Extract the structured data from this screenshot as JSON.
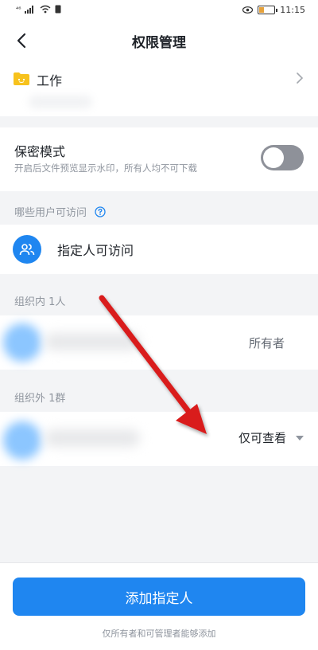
{
  "status_bar": {
    "signal_text": "⁴⁶",
    "time": "11:15",
    "battery_level": 0.35,
    "battery_color": "#e6a23c"
  },
  "nav": {
    "title": "权限管理",
    "back_icon": "chevron-left-icon"
  },
  "folder": {
    "name": "工作",
    "icon": "folder-icon",
    "icon_color": "#f7c21d"
  },
  "secret_mode": {
    "title": "保密模式",
    "description": "开启后文件预览显示水印，所有人均不可下载",
    "enabled": false
  },
  "access": {
    "section_label": "哪些用户可访问",
    "option_label": "指定人可访问",
    "icon": "people-icon",
    "accent": "#1f86f0"
  },
  "internal": {
    "section_label": "组织内 1人",
    "members": [
      {
        "role": "所有者"
      }
    ]
  },
  "external": {
    "section_label": "组织外 1群",
    "members": [
      {
        "role": "仅可查看"
      }
    ]
  },
  "footer": {
    "add_button": "添加指定人",
    "hint": "仅所有者和可管理者能够添加"
  },
  "annotation": {
    "arrow_color": "#d91a1a"
  }
}
